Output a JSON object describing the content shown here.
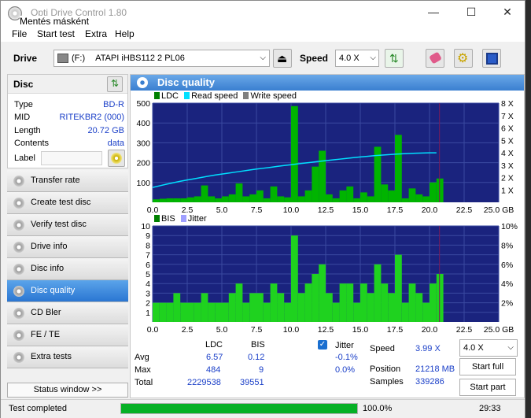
{
  "window": {
    "title": "Opti Drive Control 1.80",
    "subtitle": "Mentés másként"
  },
  "menu": [
    "File",
    "Start test",
    "Extra",
    "Help"
  ],
  "toolbar": {
    "drive_label": "Drive",
    "drive_letter": "(F:)",
    "drive_name": "ATAPI iHBS112   2 PL06",
    "speed_label": "Speed",
    "speed_value": "4.0 X"
  },
  "disc": {
    "header": "Disc",
    "fields": [
      {
        "label": "Type",
        "value": "BD-R"
      },
      {
        "label": "MID",
        "value": "RITEKBR2 (000)"
      },
      {
        "label": "Length",
        "value": "20.72 GB"
      },
      {
        "label": "Contents",
        "value": "data"
      }
    ],
    "label_field": "Label"
  },
  "nav": [
    "Transfer rate",
    "Create test disc",
    "Verify test disc",
    "Drive info",
    "Disc info",
    "Disc quality",
    "CD Bler",
    "FE / TE",
    "Extra tests"
  ],
  "nav_active": 5,
  "status_window_btn": "Status window >>",
  "panel_title": "Disc quality",
  "legend_top": {
    "ldc": "LDC",
    "read": "Read speed",
    "write": "Write speed"
  },
  "legend_bottom": {
    "bis": "BIS",
    "jitter": "Jitter"
  },
  "colors": {
    "ldc": "#00b400",
    "read": "#00e0ff",
    "write": "#a0a0a0",
    "bis": "#1fd21f",
    "jitter": "#a0a0ff",
    "plot_bg": "#1a237e"
  },
  "chart_data": [
    {
      "type": "bar",
      "x": [
        0.0,
        0.5,
        1.0,
        1.5,
        2.0,
        2.5,
        3.0,
        3.5,
        4.0,
        4.5,
        5.0,
        5.5,
        6.0,
        6.5,
        7.0,
        7.5,
        8.0,
        8.5,
        9.0,
        9.5,
        10.0,
        10.5,
        11.0,
        11.5,
        12.0,
        12.5,
        13.0,
        13.5,
        14.0,
        14.5,
        15.0,
        15.5,
        16.0,
        16.5,
        17.0,
        17.5,
        18.0,
        18.5,
        19.0,
        19.5,
        20.0,
        20.5
      ],
      "series": [
        {
          "name": "LDC",
          "values": [
            15,
            18,
            20,
            20,
            20,
            25,
            30,
            85,
            30,
            20,
            30,
            40,
            95,
            30,
            40,
            60,
            20,
            80,
            30,
            25,
            485,
            30,
            60,
            180,
            260,
            40,
            20,
            60,
            80,
            20,
            50,
            30,
            280,
            90,
            60,
            340,
            20,
            70,
            40,
            30,
            100,
            120
          ]
        },
        {
          "name": "Read speed",
          "values": [
            1.2,
            1.33,
            1.46,
            1.58,
            1.7,
            1.8,
            1.9,
            2.0,
            2.1,
            2.2,
            2.28,
            2.36,
            2.44,
            2.52,
            2.6,
            2.68,
            2.75,
            2.82,
            2.9,
            2.97,
            3.03,
            3.1,
            3.17,
            3.23,
            3.3,
            3.36,
            3.42,
            3.48,
            3.54,
            3.6,
            3.66,
            3.71,
            3.76,
            3.8,
            3.84,
            3.88,
            3.91,
            3.94,
            3.96,
            3.98,
            3.99,
            3.99
          ]
        }
      ],
      "xlim": [
        0,
        25
      ],
      "ylim": [
        0,
        500
      ],
      "y2lim": [
        0,
        8
      ],
      "xticks": [
        "0.0",
        "2.5",
        "5.0",
        "7.5",
        "10.0",
        "12.5",
        "15.0",
        "17.5",
        "20.0",
        "22.5",
        "25.0 GB"
      ],
      "yticks": [
        "100",
        "200",
        "300",
        "400",
        "500"
      ],
      "y2ticks": [
        "1 X",
        "2 X",
        "3 X",
        "4 X",
        "5 X",
        "6 X",
        "7 X",
        "8 X"
      ]
    },
    {
      "type": "bar",
      "x": [
        0.0,
        0.5,
        1.0,
        1.5,
        2.0,
        2.5,
        3.0,
        3.5,
        4.0,
        4.5,
        5.0,
        5.5,
        6.0,
        6.5,
        7.0,
        7.5,
        8.0,
        8.5,
        9.0,
        9.5,
        10.0,
        10.5,
        11.0,
        11.5,
        12.0,
        12.5,
        13.0,
        13.5,
        14.0,
        14.5,
        15.0,
        15.5,
        16.0,
        16.5,
        17.0,
        17.5,
        18.0,
        18.5,
        19.0,
        19.5,
        20.0,
        20.5
      ],
      "series": [
        {
          "name": "BIS",
          "values": [
            2,
            2,
            2,
            3,
            2,
            2,
            2,
            3,
            2,
            2,
            2,
            3,
            4,
            2,
            3,
            3,
            2,
            4,
            3,
            2,
            9,
            3,
            4,
            5,
            6,
            3,
            2,
            4,
            4,
            2,
            4,
            3,
            6,
            4,
            3,
            7,
            2,
            4,
            3,
            2,
            4,
            5
          ]
        }
      ],
      "xlim": [
        0,
        25
      ],
      "ylim": [
        0,
        10
      ],
      "y2lim": [
        0,
        10
      ],
      "xticks": [
        "0.0",
        "2.5",
        "5.0",
        "7.5",
        "10.0",
        "12.5",
        "15.0",
        "17.5",
        "20.0",
        "22.5",
        "25.0 GB"
      ],
      "yticks": [
        "1",
        "2",
        "3",
        "4",
        "5",
        "6",
        "7",
        "8",
        "9",
        "10"
      ],
      "y2ticks": [
        "2%",
        "4%",
        "6%",
        "8%",
        "10%"
      ]
    }
  ],
  "stats": {
    "col_ldc": "LDC",
    "col_bis": "BIS",
    "col_jitter": "Jitter",
    "rows": [
      {
        "label": "Avg",
        "ldc": "6.57",
        "bis": "0.12",
        "jitter": "-0.1%"
      },
      {
        "label": "Max",
        "ldc": "484",
        "bis": "9",
        "jitter": "0.0%"
      },
      {
        "label": "Total",
        "ldc": "2229538",
        "bis": "39551",
        "jitter": ""
      }
    ],
    "speed_label": "Speed",
    "speed_value": "3.99 X",
    "position_label": "Position",
    "position_value": "21218 MB",
    "samples_label": "Samples",
    "samples_value": "339286",
    "speed_select": "4.0 X",
    "start_full": "Start full",
    "start_part": "Start part"
  },
  "statusbar": {
    "text": "Test completed",
    "progress": 1.0,
    "progress_text": "100.0%",
    "time": "29:33"
  }
}
